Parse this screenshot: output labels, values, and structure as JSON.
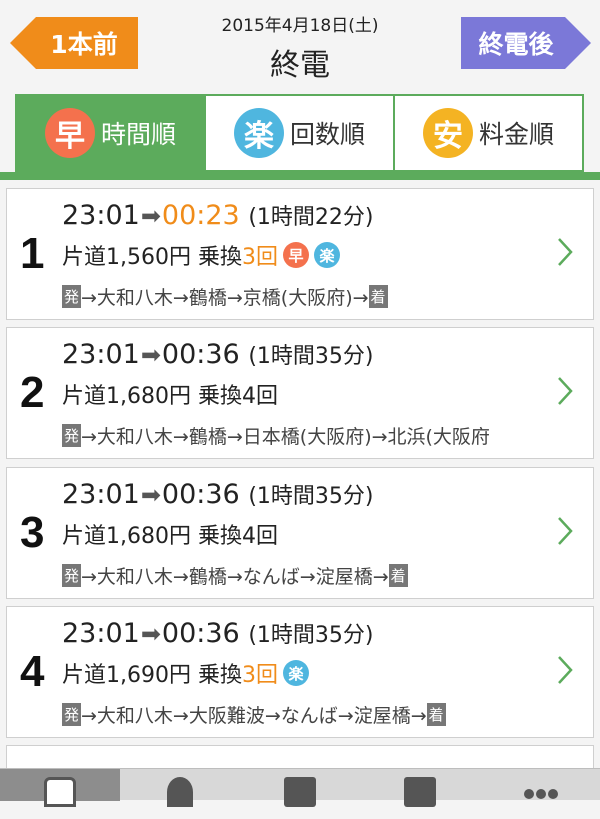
{
  "header": {
    "prev_label": "1本前",
    "date": "2015年4月18日(土)",
    "title": "終電",
    "next_label": "終電後"
  },
  "tabs": [
    {
      "badge": "早",
      "label": "時間順",
      "active": true
    },
    {
      "badge": "楽",
      "label": "回数順",
      "active": false
    },
    {
      "badge": "安",
      "label": "料金順",
      "active": false
    }
  ],
  "routes": [
    {
      "num": "1",
      "depart": "23:01",
      "arrive": "00:23",
      "duration": "(1時間22分)",
      "fare": "片道1,560円",
      "transfer_label": "乗換",
      "transfers": "3回",
      "badges": [
        "早",
        "楽"
      ],
      "path_start": "発",
      "path": "→大和八木→鶴橋→京橋(大阪府)→",
      "path_end": "着"
    },
    {
      "num": "2",
      "depart": "23:01",
      "arrive": "00:36",
      "duration": "(1時間35分)",
      "fare": "片道1,680円",
      "transfer_label": "乗換",
      "transfers": "4回",
      "badges": [],
      "path_start": "発",
      "path": "→大和八木→鶴橋→日本橋(大阪府)→北浜(大阪府",
      "path_end": ""
    },
    {
      "num": "3",
      "depart": "23:01",
      "arrive": "00:36",
      "duration": "(1時間35分)",
      "fare": "片道1,680円",
      "transfer_label": "乗換",
      "transfers": "4回",
      "badges": [],
      "path_start": "発",
      "path": "→大和八木→鶴橋→なんば→淀屋橋→",
      "path_end": "着"
    },
    {
      "num": "4",
      "depart": "23:01",
      "arrive": "00:36",
      "duration": "(1時間35分)",
      "fare": "片道1,690円",
      "transfer_label": "乗換",
      "transfers": "3回",
      "badges": [
        "楽"
      ],
      "path_start": "発",
      "path": "→大和八木→大阪難波→なんば→淀屋橋→",
      "path_end": "着"
    }
  ],
  "bottom_nav": [
    {
      "icon": "briefcase-icon",
      "active": true
    },
    {
      "icon": "person-icon",
      "active": false
    },
    {
      "icon": "document-icon",
      "active": false
    },
    {
      "icon": "info-icon",
      "active": false
    },
    {
      "icon": "more-icon",
      "active": false
    }
  ],
  "colors": {
    "orange": "#f08c1a",
    "purple": "#7b78d8",
    "green": "#5cab5c"
  }
}
